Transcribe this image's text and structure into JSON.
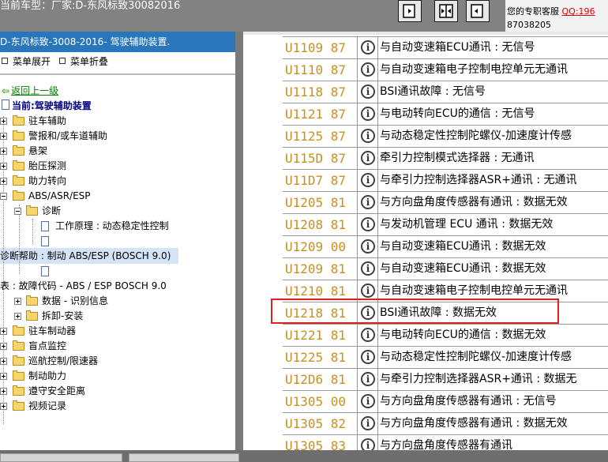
{
  "header": {
    "title": "当前车型：厂家:D-东风标致30082016",
    "service_label": "您的专职客服",
    "qq_label": "QQ:196",
    "service_number": "87038205"
  },
  "nav_buttons": [
    {
      "name": "collapse-left-button",
      "icon": "panel-left-icon"
    },
    {
      "name": "split-view-button",
      "icon": "split-view-icon"
    },
    {
      "name": "collapse-right-button",
      "icon": "panel-right-icon"
    }
  ],
  "left": {
    "panel_title": "D-东风标致-3008-2016- 驾驶辅助装置.",
    "expand_all": "菜单展开",
    "collapse_all": "菜单折叠",
    "back_link": "返回上一级",
    "current": "当前:驾驶辅助装置",
    "tree": [
      "驻车辅助",
      "警报和/或车道辅助",
      "悬架",
      "胎压探测",
      "助力转向",
      "ABS/ASR/ESP",
      "诊断",
      "工作原理 : 动态稳定性控制",
      "",
      "诊断帮助 : 制动 ABS/ESP (BOSCH 9.0)",
      "",
      "表 : 故障代码 - ABS / ESP BOSCH 9.0",
      "数据 - 识别信息",
      "拆卸-安装",
      "驻车制动器",
      "盲点监控",
      "巡航控制/限速器",
      "制动助力",
      "遵守安全距离",
      "视频记录"
    ]
  },
  "right": {
    "rows": [
      {
        "code": "U1109 87",
        "desc": "与自动变速箱ECU通讯 : 无信号"
      },
      {
        "code": "U1110 87",
        "desc": "与自动变速箱电子控制电控单元无通讯"
      },
      {
        "code": "U1118 87",
        "desc": "BSI通讯故障 : 无信号"
      },
      {
        "code": "U1121 87",
        "desc": "与电动转向ECU的通信 : 无信号"
      },
      {
        "code": "U1125 87",
        "desc": "与动态稳定性控制陀螺仪-加速度计传感"
      },
      {
        "code": "U115D 87",
        "desc": "牵引力控制模式选择器 : 无通讯"
      },
      {
        "code": "U11D7 87",
        "desc": "与牵引力控制选择器ASR+通讯 : 无通讯"
      },
      {
        "code": "U1205 81",
        "desc": "与方向盘角度传感器有通讯 : 数据无效"
      },
      {
        "code": "U1208 81",
        "desc": "与发动机管理 ECU 通讯 : 数据无效"
      },
      {
        "code": "U1209 00",
        "desc": "与自动变速箱ECU通讯 : 数据无效"
      },
      {
        "code": "U1209 81",
        "desc": "与自动变速箱ECU通讯 : 数据无效"
      },
      {
        "code": "U1210 81",
        "desc": "与自动变速箱电子控制电控单元无通讯"
      },
      {
        "code": "U1218 81",
        "desc": "BSI通讯故障 : 数据无效"
      },
      {
        "code": "U1221 81",
        "desc": "与电动转向ECU的通信 : 数据无效"
      },
      {
        "code": "U1225 81",
        "desc": "与动态稳定性控制陀螺仪-加速度计传感"
      },
      {
        "code": "U12D6 81",
        "desc": "与牵引力控制选择器ASR+通讯 : 数据无"
      },
      {
        "code": "U1305 00",
        "desc": "与方向盘角度传感器有通讯 : 无信号"
      },
      {
        "code": "U1305 82",
        "desc": "与方向盘角度传感器有通讯 : 数据无效"
      },
      {
        "code": "U1305 83",
        "desc": "与方向盘角度传感器有通讯"
      }
    ],
    "info_glyph": "i",
    "highlighted_code": "U1218 81"
  },
  "colors": {
    "title_bar": "#828282",
    "panel_title_bg": "#2a76bb",
    "code_text": "#c8901e",
    "highlight_box": "#e02020",
    "back_link": "#008000",
    "current_label": "#000080"
  }
}
